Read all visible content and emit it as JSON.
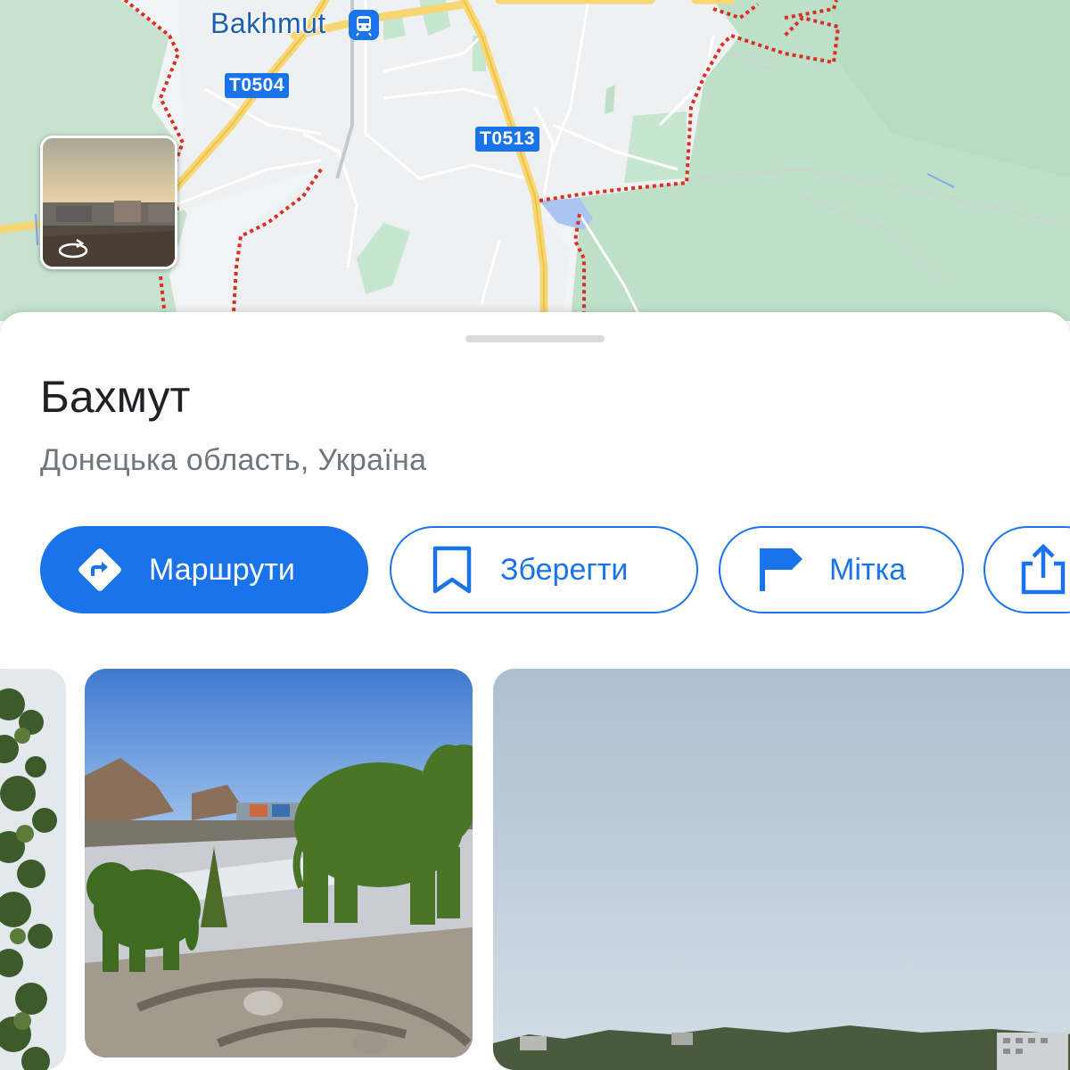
{
  "map": {
    "city_label": "Bakhmut",
    "road_shields": [
      "T0504",
      "T0513"
    ],
    "streetview_thumbnail_icon": "rotate-360-icon",
    "transit_icon": "train-station-icon"
  },
  "place": {
    "title": "Бахмут",
    "subtitle": "Донецька область, Україна"
  },
  "actions": {
    "directions": {
      "label": "Маршрути",
      "icon": "directions-icon"
    },
    "save": {
      "label": "Зберегти",
      "icon": "bookmark-icon"
    },
    "label": {
      "label": "Мітка",
      "icon": "flag-icon"
    },
    "share": {
      "label": "",
      "icon": "share-icon"
    }
  },
  "colors": {
    "accent": "#1a73e8",
    "title_text": "#202124",
    "subtitle_text": "#70757a",
    "map_green": "#bfe0c8",
    "border_dashed": "#d93025"
  }
}
